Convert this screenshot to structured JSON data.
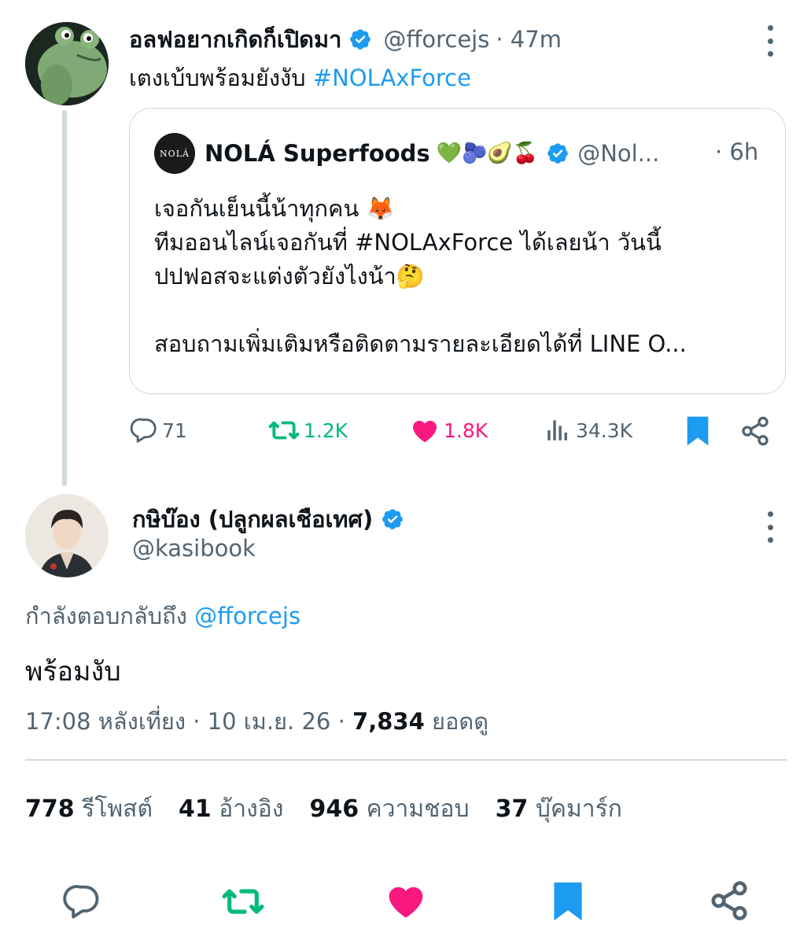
{
  "parent_tweet": {
    "display_name": "อลฟอยากเกิดก็เปิดมา",
    "handle": "@fforcejs",
    "time": "· 47m",
    "text_prefix": "เตงเบ้บพร้อมยังงับ",
    "hashtag": "#NOLAxForce",
    "quote": {
      "avatar_text": "NOLÁ",
      "display_name": "NOLÁ Superfoods",
      "emojis": "💚🫐🥑🍒",
      "handle": "@Nol...",
      "time": "· 6h",
      "line1": "เจอกันเย็นนี้น้าทุกคน 🦊",
      "line2": "ทีมออนไลน์เจอกันที่ #NOLAxForce ได้เลยน้า วันนี้",
      "line3": "ปปฟอสจะแต่งตัวยังไงน้า🤔",
      "line4": "สอบถามเพิ่มเติมหรือติดตามรายละเอียดได้ที่ LINE O..."
    },
    "actions": {
      "replies": "71",
      "retweets": "1.2K",
      "likes": "1.8K",
      "views": "34.3K"
    }
  },
  "main_tweet": {
    "display_name": "กษิบ๊อง (ปลูกผลเชือเทศ)",
    "handle": "@kasibook",
    "replying_label": "กำลังตอบกลับถึง",
    "replying_to": "@fforcejs",
    "text": "พร้อมงับ",
    "timestamp": "17:08 หลังเที่ยง · 10 เม.ย. 26 · ",
    "views_count": "7,834",
    "views_label": "ยอดดู"
  },
  "stats": [
    {
      "count": "778",
      "label": "รีโพสต์"
    },
    {
      "count": "41",
      "label": "อ้างอิง"
    },
    {
      "count": "946",
      "label": "ความชอบ"
    },
    {
      "count": "37",
      "label": "บุ๊คมาร์ก"
    }
  ],
  "colors": {
    "accent": "#1d9bf0",
    "retweet": "#00ba7c",
    "like": "#f91880",
    "muted": "#536471",
    "border": "#cfd9de"
  },
  "icons": [
    "reply-icon",
    "retweet-icon",
    "like-icon",
    "views-icon",
    "bookmark-icon",
    "share-icon",
    "verified-icon",
    "more-icon"
  ]
}
